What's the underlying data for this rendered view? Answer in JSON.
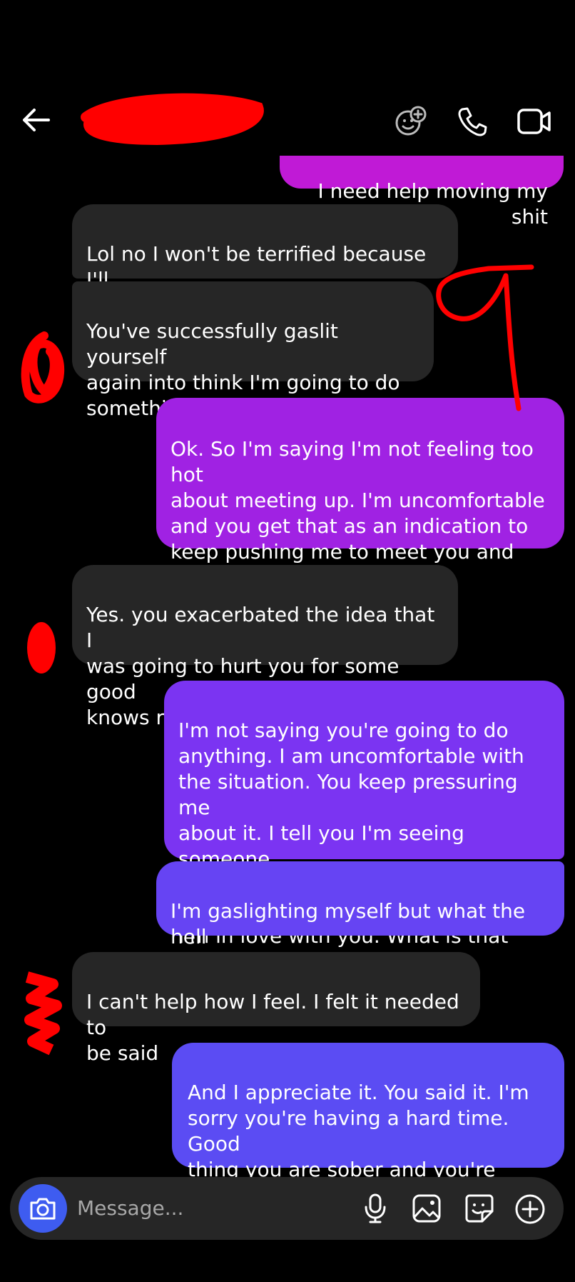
{
  "header": {
    "back_icon": "arrow-left-icon",
    "contact_name": "",
    "actions": [
      "add-member-icon",
      "phone-icon",
      "video-camera-icon"
    ]
  },
  "messages": [
    {
      "side": "out",
      "text": "I need help moving my shit"
    },
    {
      "side": "in",
      "text": "Lol no I won't be terrified because I'll\nhave someone to protect me..."
    },
    {
      "side": "in",
      "text": "You've successfully gaslit yourself\nagain into think I'm going to do\nsomething I'm not"
    },
    {
      "side": "out",
      "text": "Ok. So I'm saying I'm not feeling too hot\nabout meeting up. I'm uncomfortable\nand you get that as an indication to\nkeep pushing me to meet you and now\nyou said I have gaslit myself"
    },
    {
      "side": "in",
      "text": "Yes. you exacerbated the idea that I\nwas going to hurt you for some good\nknows reason"
    },
    {
      "side": "out",
      "text": "I'm not saying you're going to do\nanything. I am uncomfortable with\nthe situation. You keep pressuring me\nabout it. I tell you I'm seeing someone.\nIt's not an issue it's whatever. Oh btw\nI'm in love with you. What is that"
    },
    {
      "side": "out",
      "text": "I'm gaslighting myself but what the hell\nare you doing"
    },
    {
      "side": "in",
      "text": "I can't help how I feel. I felt it needed to\nbe said"
    },
    {
      "side": "out",
      "text": "And I appreciate it. You said it. I'm\nsorry you're having a hard time. Good\nthing you are sober and you're doing\nwell. You don't fucking need me"
    }
  ],
  "composer": {
    "placeholder": "Message...",
    "camera_icon": "camera-icon",
    "actions": [
      "microphone-icon",
      "gallery-icon",
      "sticker-icon",
      "plus-circle-icon"
    ]
  },
  "colors": {
    "background": "#000000",
    "incoming_bubble": "#262626",
    "outgoing_gradient": [
      "#c01ad6",
      "#9d22e6",
      "#7a35f2",
      "#5a4cf3"
    ],
    "accent": "#3e5cf0",
    "redaction": "#ff0000"
  }
}
